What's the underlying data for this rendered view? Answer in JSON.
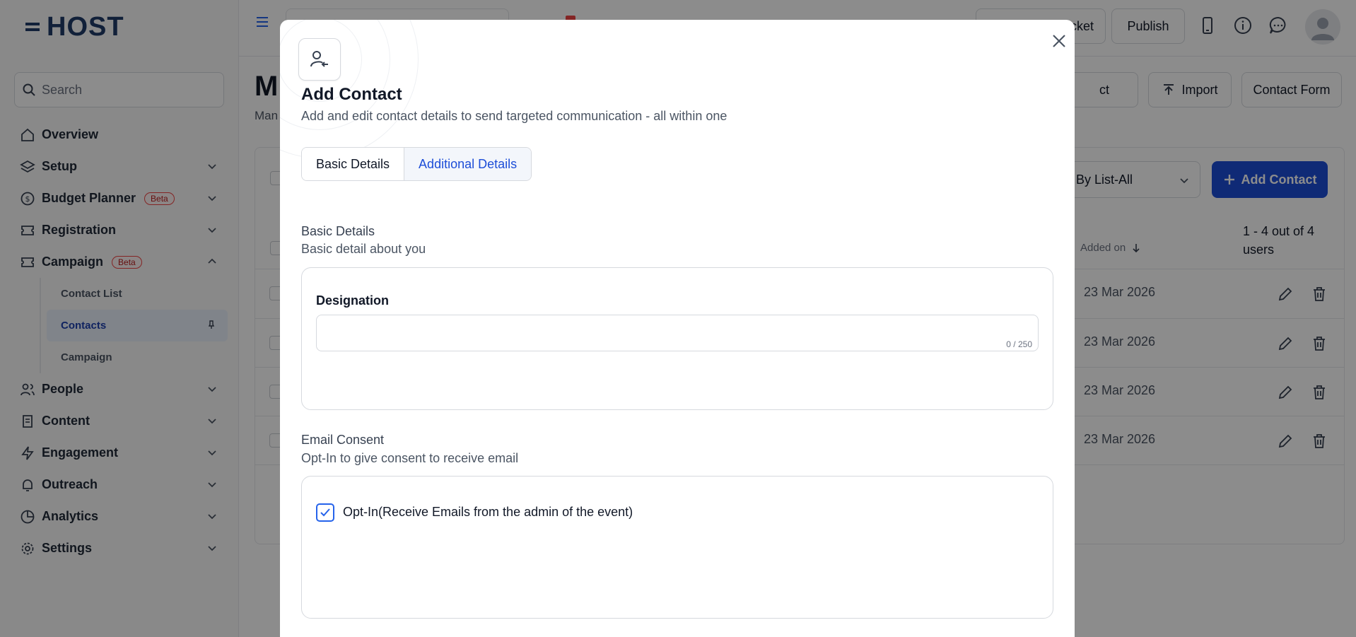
{
  "app": {
    "logo_text": "HOST"
  },
  "sidebar": {
    "search_placeholder": "Search",
    "items": [
      {
        "label": "Overview"
      },
      {
        "label": "Setup"
      },
      {
        "label": "Budget Planner",
        "badge": "Beta"
      },
      {
        "label": "Registration"
      },
      {
        "label": "Campaign",
        "badge": "Beta"
      },
      {
        "label": "People"
      },
      {
        "label": "Content"
      },
      {
        "label": "Engagement"
      },
      {
        "label": "Outreach"
      },
      {
        "label": "Analytics"
      },
      {
        "label": "Settings"
      }
    ],
    "campaign_sub": [
      {
        "label": "Contact List"
      },
      {
        "label": "Contacts"
      },
      {
        "label": "Campaign"
      }
    ]
  },
  "topbar": {
    "ticket_label": "cket",
    "publish_label": "Publish"
  },
  "page": {
    "title": "M",
    "subtitle": "Man",
    "buttons": {
      "contact_partial": "ct",
      "import": "Import",
      "contact_form": "Contact Form"
    },
    "filter_value": "er By List-All",
    "add_contact": "Add Contact",
    "table": {
      "added_on_header": "Added on",
      "count": "1 - 4 out of 4 users",
      "rows": [
        {
          "date": "23 Mar 2026"
        },
        {
          "date": "23 Mar 2026"
        },
        {
          "date": "23 Mar 2026"
        },
        {
          "date": "23 Mar 2026"
        }
      ]
    }
  },
  "modal": {
    "title": "Add Contact",
    "description": "Add and edit contact details to send targeted communication - all within one",
    "tabs": [
      {
        "label": "Basic Details"
      },
      {
        "label": "Additional Details"
      }
    ],
    "section1": {
      "title": "Basic Details",
      "subtitle": "Basic detail about you",
      "field_label": "Designation",
      "field_value": "",
      "counter": "0 / 250"
    },
    "section2": {
      "title": "Email Consent",
      "subtitle": "Opt-In to give consent to receive email",
      "checkbox_label": "Opt-In(Receive Emails from the admin of the event)",
      "checked": true
    }
  },
  "colors": {
    "primary": "#1d4ed8",
    "beta": "#ef4444",
    "overlay": "rgba(0,0,0,0.45)"
  }
}
